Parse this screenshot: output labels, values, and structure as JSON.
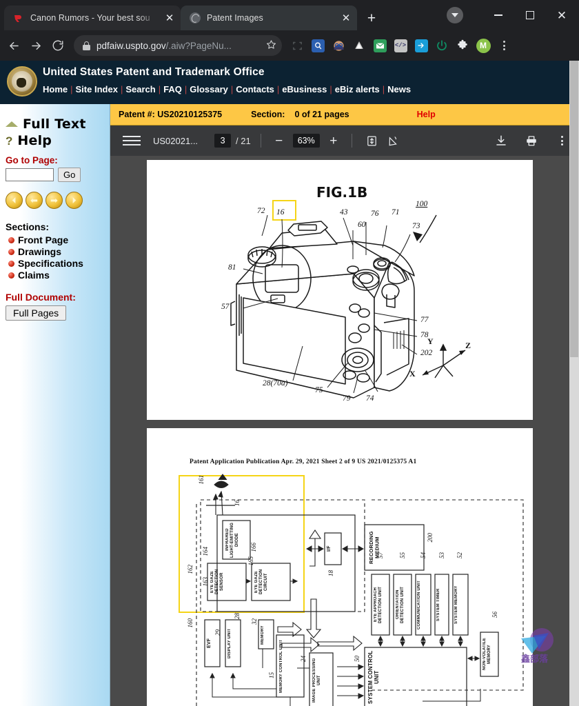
{
  "browser": {
    "tabs": [
      {
        "title": "Canon Rumors - Your best sou",
        "favicon": "canon-logo-icon",
        "active": false
      },
      {
        "title": "Patent Images",
        "favicon": "globe-icon",
        "active": true
      }
    ],
    "new_tab_label": "+",
    "close_label": "✕",
    "window": {
      "minimize": "–",
      "maximize": "□",
      "close": "✕"
    },
    "nav": {
      "back": "←",
      "forward": "→",
      "reload": "↻"
    },
    "omnibox": {
      "secure_icon": "lock-icon",
      "url_bold": "pdfaiw.uspto.gov",
      "url_dim": "/.aiw?PageNu...",
      "bookmark_icon": "star-icon"
    },
    "extensions": [
      {
        "name": "capture-icon",
        "glyph": "⬚",
        "color": "#3c4043"
      },
      {
        "name": "search-magnifier-icon",
        "glyph": "⌕",
        "color": "#2b5fb0"
      },
      {
        "name": "avatar-glasses-icon",
        "glyph": "◕",
        "color": "#c98b64"
      },
      {
        "name": "onenote-icon",
        "glyph": "◧",
        "color": "#e8e8e8"
      },
      {
        "name": "mail-envelope-icon",
        "glyph": "✉",
        "color": "#2e9e5b"
      },
      {
        "name": "code-brackets-icon",
        "glyph": "</>",
        "color": "#b9b9b9"
      },
      {
        "name": "export-arrow-icon",
        "glyph": "➡",
        "color": "#1a9ed9"
      },
      {
        "name": "power-icon",
        "glyph": "⏻",
        "color": "#0f8a62"
      },
      {
        "name": "puzzle-extension-icon",
        "glyph": "❖",
        "color": "#e8eaed"
      },
      {
        "name": "profile-avatar-icon",
        "glyph": "M",
        "color": "#8bc34a"
      },
      {
        "name": "chrome-menu-icon",
        "glyph": "⋮",
        "color": "#cfd1d3"
      }
    ]
  },
  "uspto": {
    "title": "United States Patent and Trademark Office",
    "nav": [
      "Home",
      "Site Index",
      "Search",
      "FAQ",
      "Glossary",
      "Contacts",
      "eBusiness",
      "eBiz alerts",
      "News"
    ]
  },
  "sidebar": {
    "full_text": "Full Text",
    "help": "Help",
    "goto_label": "Go to Page:",
    "goto_value": "",
    "goto_placeholder": "",
    "go_button": "Go",
    "nav_arrows": [
      "first-page-arrow",
      "previous-page-arrow",
      "next-page-arrow",
      "last-page-arrow"
    ],
    "sections_label": "Sections:",
    "sections": [
      "Front Page",
      "Drawings",
      "Specifications",
      "Claims"
    ],
    "full_document_label": "Full Document:",
    "full_pages_button": "Full Pages"
  },
  "yellow_bar": {
    "patent_label": "Patent #:",
    "patent_number": "US20210125375",
    "section_label": "Section:",
    "section_value": "0 of 21 pages",
    "help": "Help"
  },
  "pdf_toolbar": {
    "menu_icon": "hamburger-menu-icon",
    "filename": "US02021...",
    "current_page": "3",
    "total_pages": "/ 21",
    "zoom_out": "−",
    "zoom_level": "63%",
    "zoom_in": "+",
    "fit_page_icon": "fit-to-page-icon",
    "rotate_icon": "rotate-icon",
    "download_icon": "download-icon",
    "print_icon": "print-icon",
    "more_icon": "more-options-icon"
  },
  "figure_1b": {
    "title": "FIG.1B",
    "ref_numbers": [
      "72",
      "16",
      "43",
      "76",
      "71",
      "60",
      "73",
      "100",
      "81",
      "57",
      "77",
      "78",
      "202",
      "28(70a)",
      "75",
      "79",
      "74"
    ],
    "axes": [
      "Y",
      "Z",
      "X"
    ],
    "highlight_color": "#f5d417"
  },
  "figure_2": {
    "publication_header": "Patent Application Publication     Apr. 29, 2021  Sheet 2 of 9       US 2021/0125375 A1",
    "blocks": [
      {
        "label": "INFRARED LIGHT-EMITTING DIODE",
        "ref": ""
      },
      {
        "label": "EYE GAZE DETECTION SENSOR",
        "ref": "164"
      },
      {
        "label": "EYE GAZE DETECTION CIRCUIT",
        "ref": "165"
      },
      {
        "label": "I/F",
        "ref": "18"
      },
      {
        "label": "RECORDING MEDIUM",
        "ref": "200"
      },
      {
        "label": "EVF",
        "ref": "29"
      },
      {
        "label": "DISPLAY UNIT",
        "ref": "28"
      },
      {
        "label": "MEMORY",
        "ref": "32"
      },
      {
        "label": "MEMORY CONTROL UNIT",
        "ref": "15"
      },
      {
        "label": "IMAGE PROCESSING UNIT",
        "ref": "24"
      },
      {
        "label": "EYE APPROACH DETECTION UNIT",
        "ref": "57"
      },
      {
        "label": "ORIENTATION DETECTION UNIT",
        "ref": "55"
      },
      {
        "label": "COMMUNICATION UNIT",
        "ref": "54"
      },
      {
        "label": "SYSTEM TIMER",
        "ref": "53"
      },
      {
        "label": "SYSTEM MEMORY",
        "ref": "52"
      },
      {
        "label": "SYSTEM CONTROL UNIT",
        "ref": "50"
      },
      {
        "label": "NON-VOLATILE MEMORY",
        "ref": "56"
      }
    ],
    "lead_numbers": [
      "161",
      "16",
      "166",
      "162",
      "163",
      "160"
    ],
    "highlight_color": "#f5d417"
  },
  "watermark": {
    "text": "鑫部落"
  },
  "scrollbars": {
    "page_scroll": "vertical-scrollbar",
    "window_scroll": "window-vertical-scrollbar"
  }
}
